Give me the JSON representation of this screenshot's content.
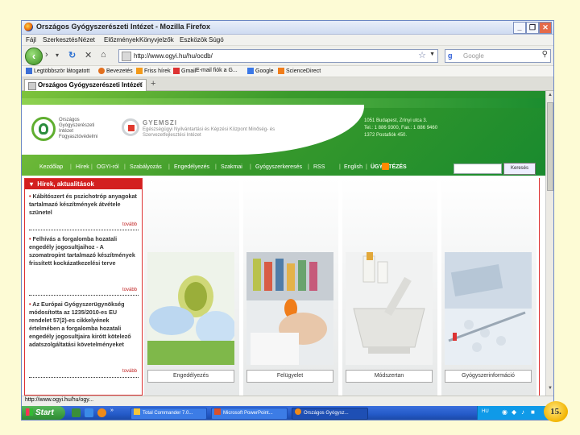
{
  "window": {
    "title": "Országos Gyógyszerészeti Intézet - Mozilla Firefox"
  },
  "menu": [
    "Fájl",
    "Szerkesztés",
    "Nézet",
    "Előzmények",
    "Könyvjelzők",
    "Eszközök",
    "Súgó"
  ],
  "navbar": {
    "url": "http://www.ogyi.hu/hu/ocdb/",
    "search_placeholder": "Google"
  },
  "bookmarks": [
    "Legtöbbször látogatott",
    "Bevezetés",
    "Friss hírek",
    "Gmail",
    "E-mail fiók a G...",
    "Google",
    "ScienceDirect"
  ],
  "tab": {
    "label": "Országos Gyógyszerészeti Intézet"
  },
  "site": {
    "org_lines": [
      "Országos",
      "Gyógyszerészeti",
      "Intézet",
      "Fogyasztóvédelmi"
    ],
    "gyemszi": "GYEMSZI",
    "gyemszi_sub": "Egészségügyi Nyilvántartási és Képzési Központ Minőség- és Szervezetfejlesztési Intézet",
    "address": [
      "1051 Budapest, Zrínyi utca 3.",
      "Tel.: 1 886 9300, Fax.: 1 886 9460",
      "1372 Postafiók 450."
    ],
    "nav": [
      "Kezdőlap",
      "Hírek",
      "OGYI-ról",
      "Szabályozás",
      "Engedélyezés",
      "Szakmai",
      "Gyógyszerkeresés",
      "RSS",
      "English",
      "ÜGYINTÉZÉS"
    ],
    "search_button": "Keresés",
    "news_title": "Hírek, aktualitások",
    "news": [
      {
        "text": "Kábítószert és pszichotróp anyagokat tartalmazó készítmények átvétele szünetel",
        "more": "tovább"
      },
      {
        "text": "Felhívás a forgalomba hozatali engedély jogosultjaihoz - A szomatropint tartalmazó készítmények frissített kockázatkezelési terve",
        "more": "tovább"
      },
      {
        "text": "Az Európai Gyógyszerügynökség módosította az 1235/2010-es EU rendelet 57(2)-es cikkelyének értelmében a forgalomba hozatali engedély jogosultjaira kirótt kötelező adatszolgáltatási követelményeket",
        "more": "tovább"
      }
    ],
    "tiles": [
      "Engedélyezés",
      "Felügyelet",
      "Módszertan",
      "Gyógyszerinformáció"
    ]
  },
  "statusbar": "http://www.ogyi.hu/hu/ogy...",
  "taskbar": {
    "start": "Start",
    "items": [
      "Total Commander 7.0...",
      "Microsoft PowerPoint...",
      "Országos Gyógysz..."
    ],
    "tray_lang": "HU"
  },
  "slide_number": "15."
}
